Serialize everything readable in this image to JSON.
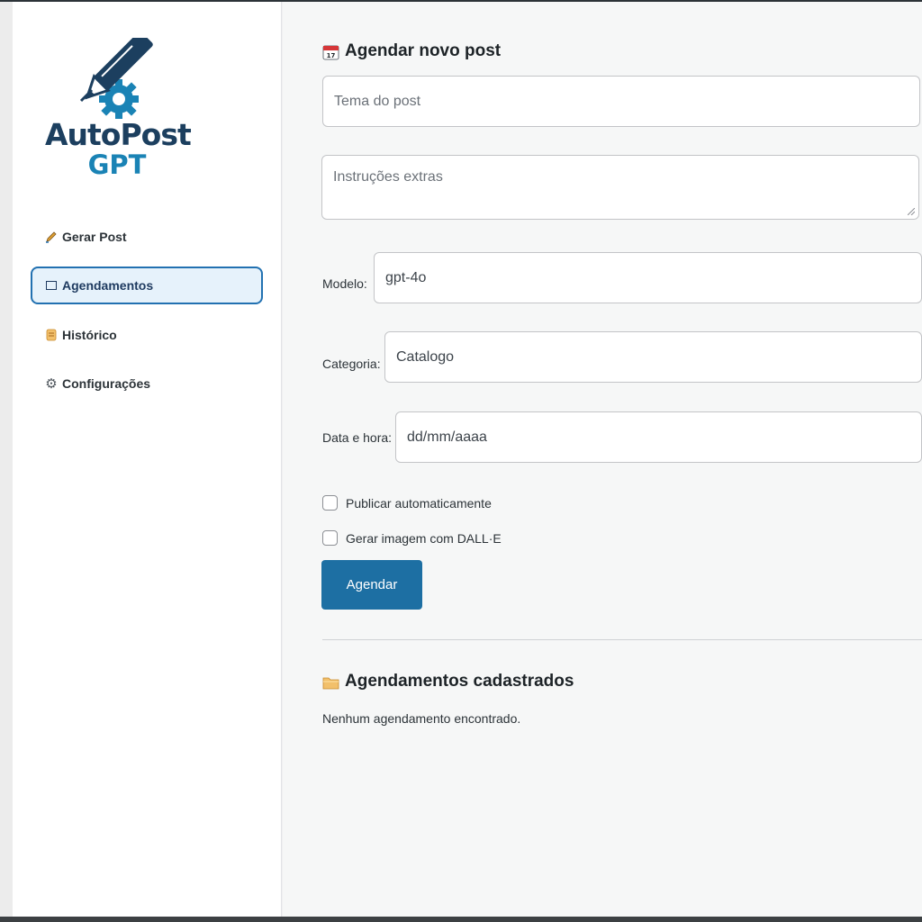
{
  "brand": {
    "line1": "AutoPost",
    "line2": "GPT"
  },
  "nav": {
    "items": [
      {
        "label": "Gerar Post",
        "icon": "pencil-icon"
      },
      {
        "label": "Agendamentos",
        "icon": "window-icon"
      },
      {
        "label": "Histórico",
        "icon": "scroll-icon"
      },
      {
        "label": "Configurações",
        "icon": "gear-icon"
      }
    ],
    "active_index": 1
  },
  "form": {
    "title": "Agendar novo post",
    "topic_placeholder": "Tema do post",
    "instructions_placeholder": "Instruções extras",
    "model_label": "Modelo:",
    "model_value": "gpt-4o",
    "category_label": "Categoria:",
    "category_value": "Catalogo",
    "datetime_label": "Data e hora:",
    "datetime_value": "dd/mm/aaaa",
    "auto_publish_label": "Publicar automaticamente",
    "dalle_label": "Gerar imagem com DALL·E",
    "submit_label": "Agendar"
  },
  "list": {
    "title": "Agendamentos cadastrados",
    "empty_text": "Nenhum agendamento encontrado."
  },
  "colors": {
    "accent": "#1d6fa3",
    "brand_dark": "#1c3f5f",
    "brand_light": "#1a83b5",
    "active_border": "#2271b1"
  }
}
